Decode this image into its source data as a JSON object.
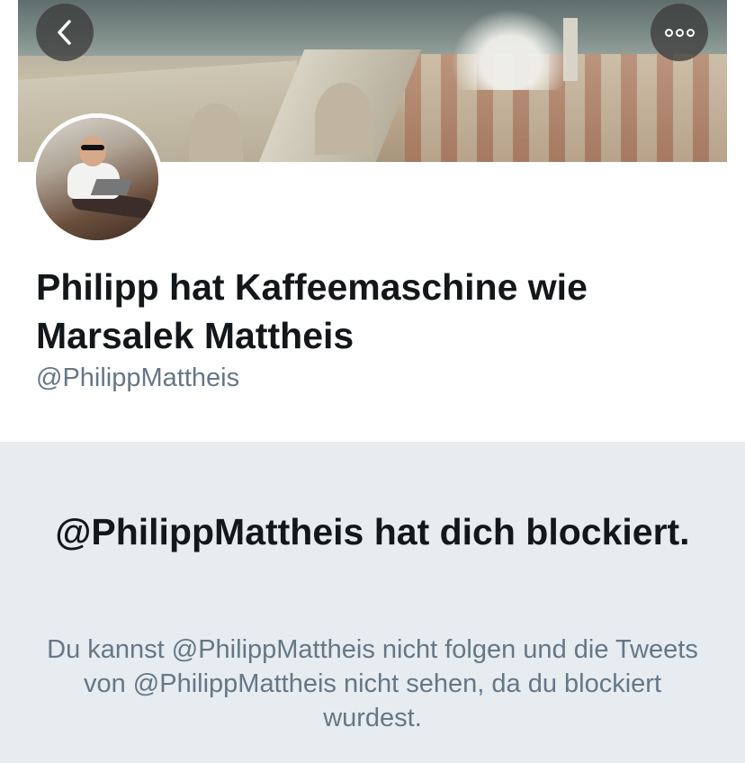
{
  "profile": {
    "display_name": "Philipp hat Kaffeemaschine wie Marsalek Mattheis",
    "handle": "@PhilippMattheis"
  },
  "header": {
    "back_icon": "chevron-left-icon",
    "more_icon": "more-options-icon"
  },
  "blocked": {
    "title": "@PhilippMattheis hat dich blockiert.",
    "message": "Du kannst @PhilippMattheis nicht folgen und die Tweets von @PhilippMattheis nicht sehen, da du blockiert wurdest."
  },
  "colors": {
    "text_primary": "#14171a",
    "text_secondary": "#657786",
    "panel_background": "#e6ecf0"
  }
}
